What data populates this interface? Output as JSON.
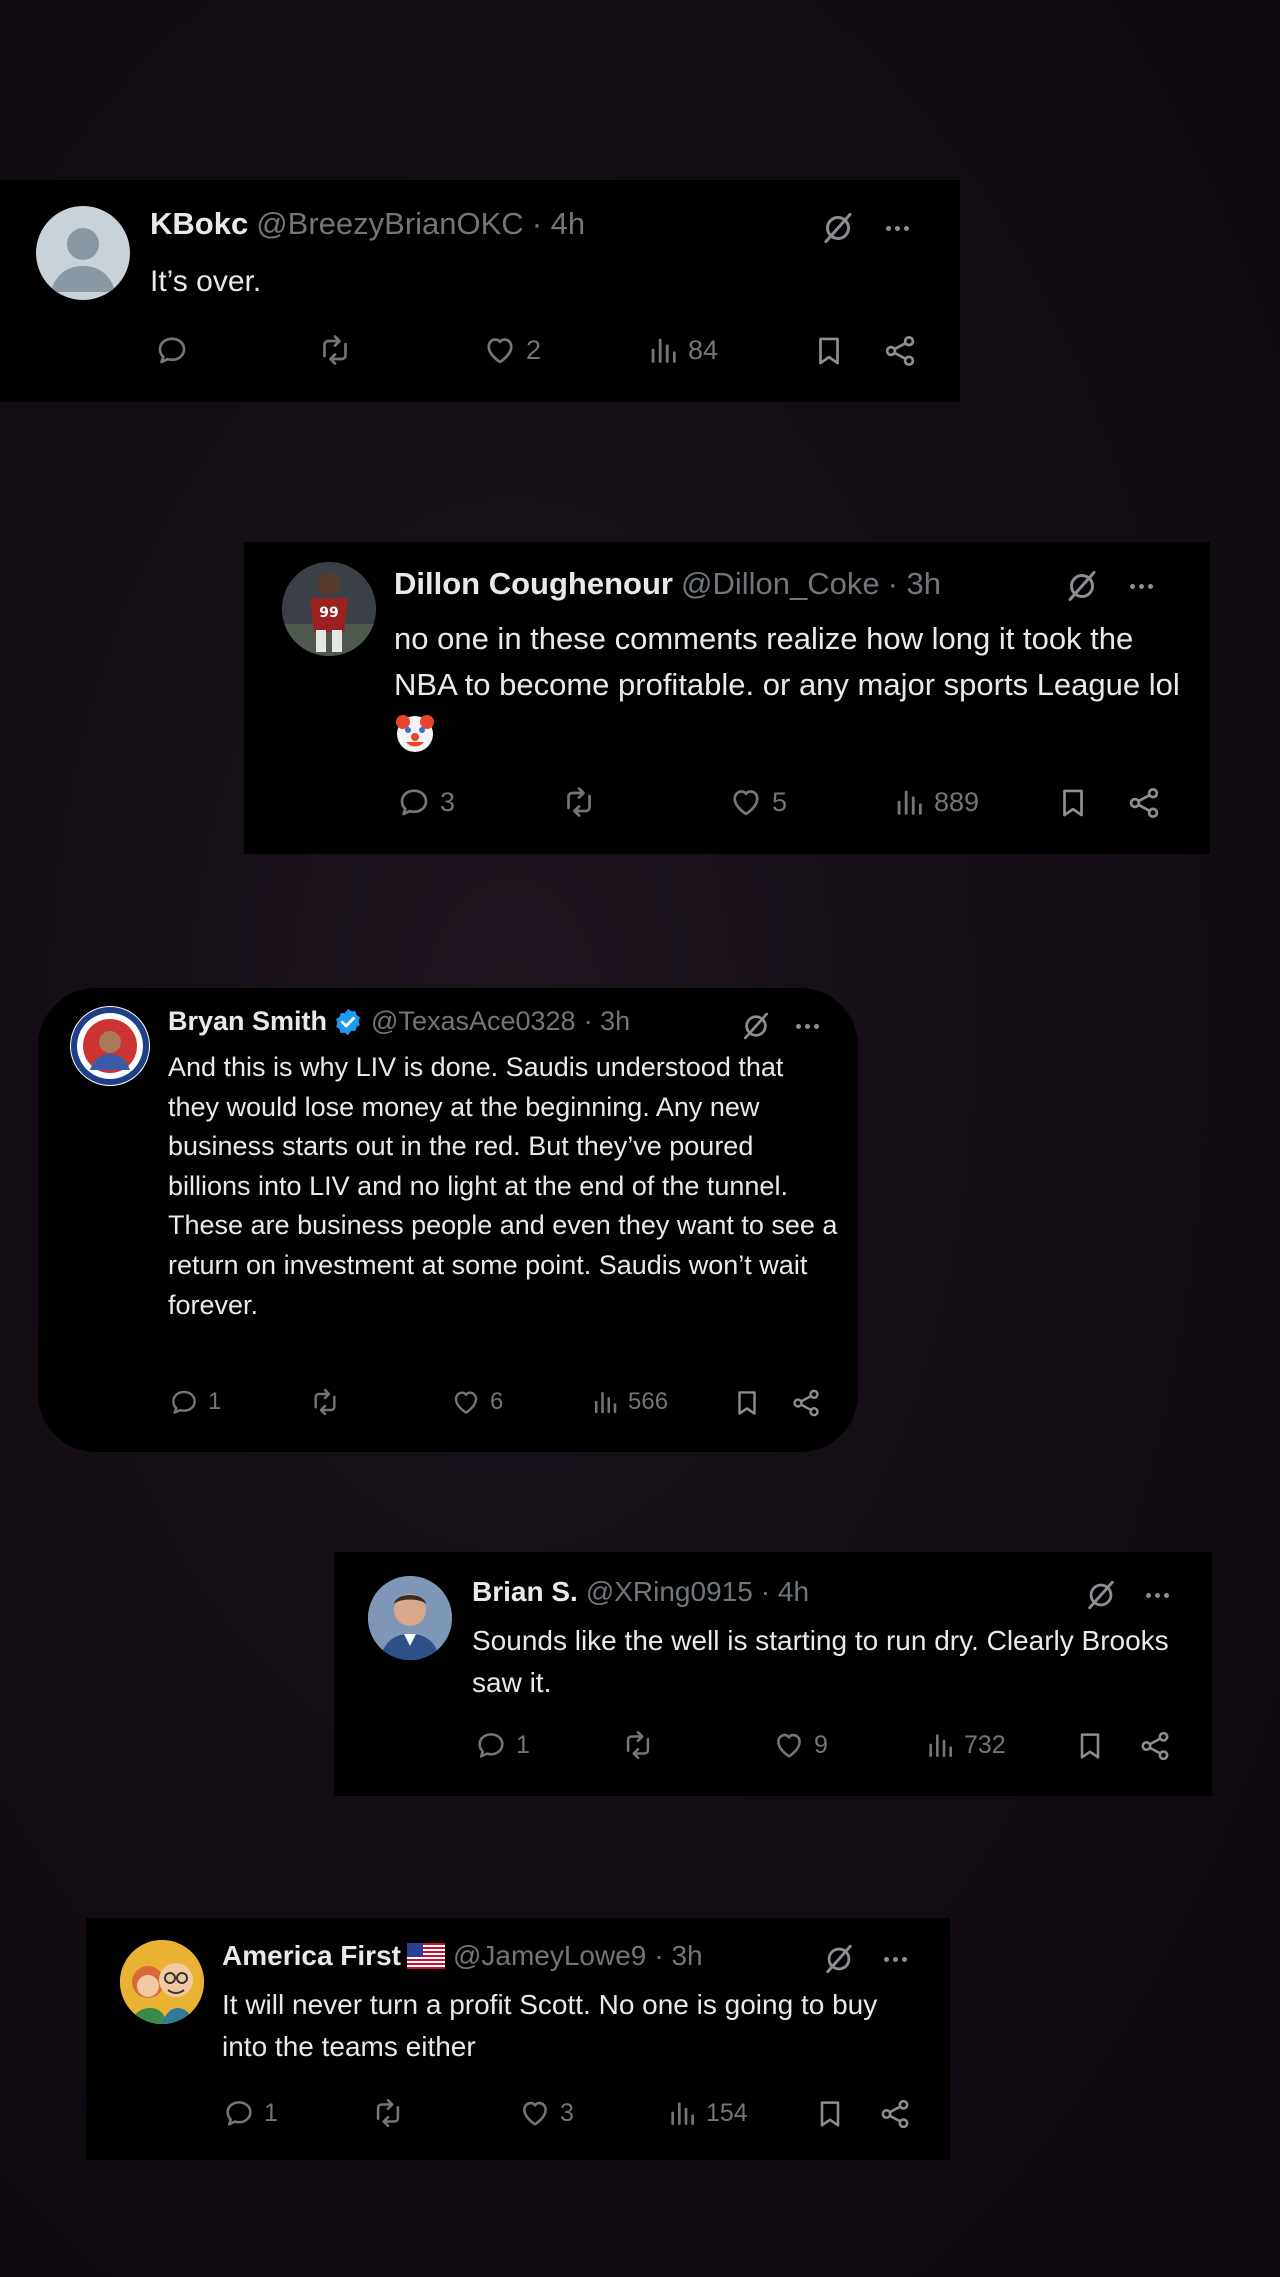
{
  "tweets": [
    {
      "name": "KBokc",
      "handle": "@BreezyBrianOKC",
      "time": "· 4h",
      "text": "It’s over.",
      "replies": "",
      "likes": "2",
      "views": "84",
      "avatar": "default-profile"
    },
    {
      "name": "Dillon Coughenour",
      "handle": "@Dillon_Coke",
      "time": "· 3h",
      "text": "no one in these comments realize how long it took the NBA to become profitable. or any major sports League lol",
      "emoji": "clown-face",
      "replies": "3",
      "likes": "5",
      "views": "889",
      "avatar": "football-player-99"
    },
    {
      "name": "Bryan Smith",
      "handle": "@TexasAce0328",
      "time": "· 3h",
      "text": "And this is why LIV is done. Saudis understood that they would lose money at the beginning. Any new business starts out in the red. But they’ve poured billions into LIV and no light at the end of the tunnel. These are business people and even they want to see a return on investment at some point. Saudis won’t wait forever.",
      "replies": "1",
      "likes": "6",
      "views": "566",
      "verified": true,
      "avatar": "circular-badge"
    },
    {
      "name": "Brian S.",
      "handle": "@XRing0915",
      "time": "· 4h",
      "text": "Sounds like the well is starting to run dry. Clearly Brooks saw it.",
      "replies": "1",
      "likes": "9",
      "views": "732",
      "avatar": "man-portrait"
    },
    {
      "name": "America First",
      "handle": "@JameyLowe9",
      "time": "· 3h",
      "text": "It will never turn a profit Scott.  No one is going to buy into the teams either",
      "replies": "1",
      "likes": "3",
      "views": "154",
      "flag": "us-flag",
      "avatar": "cartoon-couple"
    }
  ],
  "colors": {
    "name": "#e7e9ea",
    "muted": "#71767b",
    "verified": "#1d9bf0",
    "card": "#000000"
  }
}
